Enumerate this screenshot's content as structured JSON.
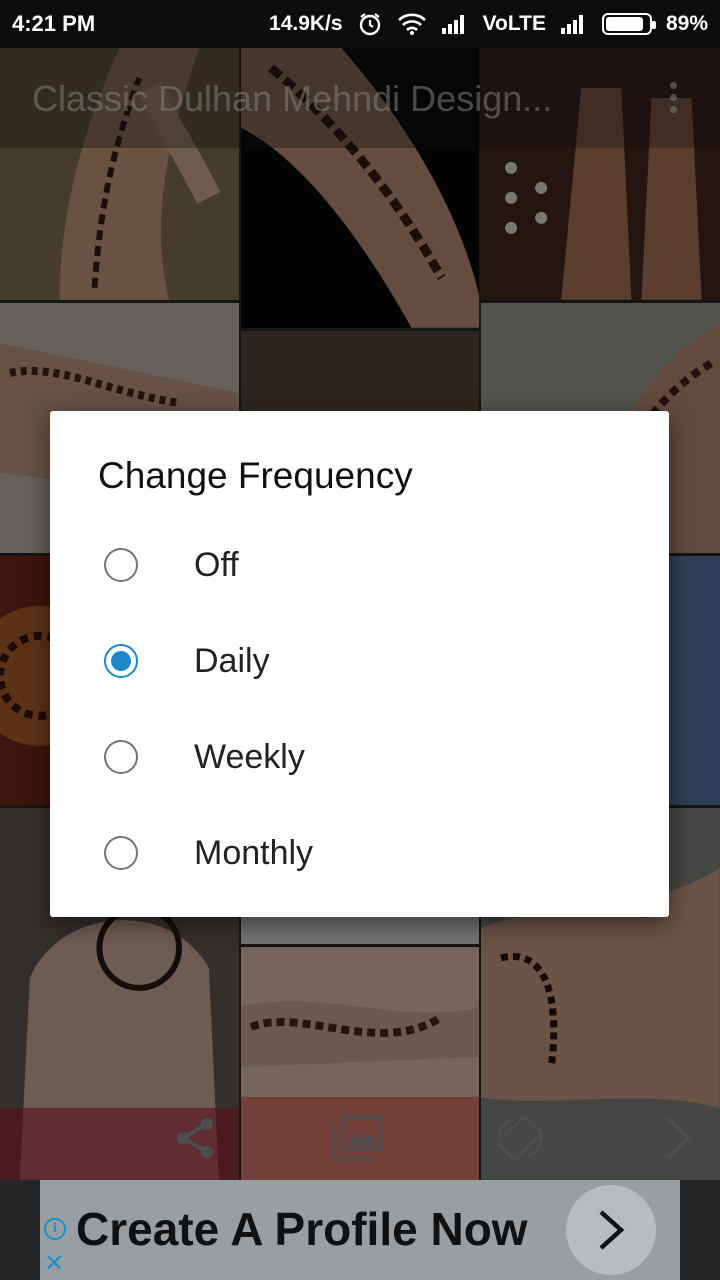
{
  "status_bar": {
    "time": "4:21 PM",
    "net_speed": "14.9K/s",
    "network": "VoLTE",
    "battery": "89%",
    "battery_level": 0.89
  },
  "app_bar": {
    "title": "Classic Dulhan Mehndi Design..."
  },
  "dialog": {
    "title": "Change Frequency",
    "options": [
      {
        "label": "Off",
        "checked": false
      },
      {
        "label": "Daily",
        "checked": true
      },
      {
        "label": "Weekly",
        "checked": false
      },
      {
        "label": "Monthly",
        "checked": false
      }
    ]
  },
  "toolbar": {
    "icons": [
      "share-icon",
      "gallery-icon",
      "rotate-icon",
      "next-icon"
    ]
  },
  "ad": {
    "text": "Create A Profile Now",
    "info_glyph": "i",
    "close_glyph": "✕"
  }
}
